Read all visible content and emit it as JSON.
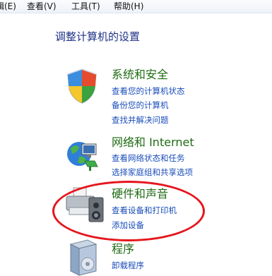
{
  "menubar": {
    "items": [
      {
        "label": "辑(E)"
      },
      {
        "label": "查看(V)"
      },
      {
        "label": "工具(T)"
      },
      {
        "label": "帮助(H)"
      }
    ]
  },
  "page_title": "调整计算机的设置",
  "categories": [
    {
      "title": "系统和安全",
      "icon": "shield-icon",
      "links": [
        "查看您的计算机状态",
        "备份您的计算机",
        "查找并解决问题"
      ]
    },
    {
      "title": "网络和 Internet",
      "icon": "network-globe-icon",
      "links": [
        "查看网络状态和任务",
        "选择家庭组和共享选项"
      ]
    },
    {
      "title": "硬件和声音",
      "icon": "printer-speaker-icon",
      "links": [
        "查看设备和打印机",
        "添加设备"
      ]
    },
    {
      "title": "程序",
      "icon": "programs-box-icon",
      "links": [
        "卸载程序"
      ]
    }
  ],
  "colors": {
    "category_title": "#1f6b13",
    "link": "#1a4dbb",
    "page_title": "#1e3287",
    "highlight": "#e5161d"
  }
}
